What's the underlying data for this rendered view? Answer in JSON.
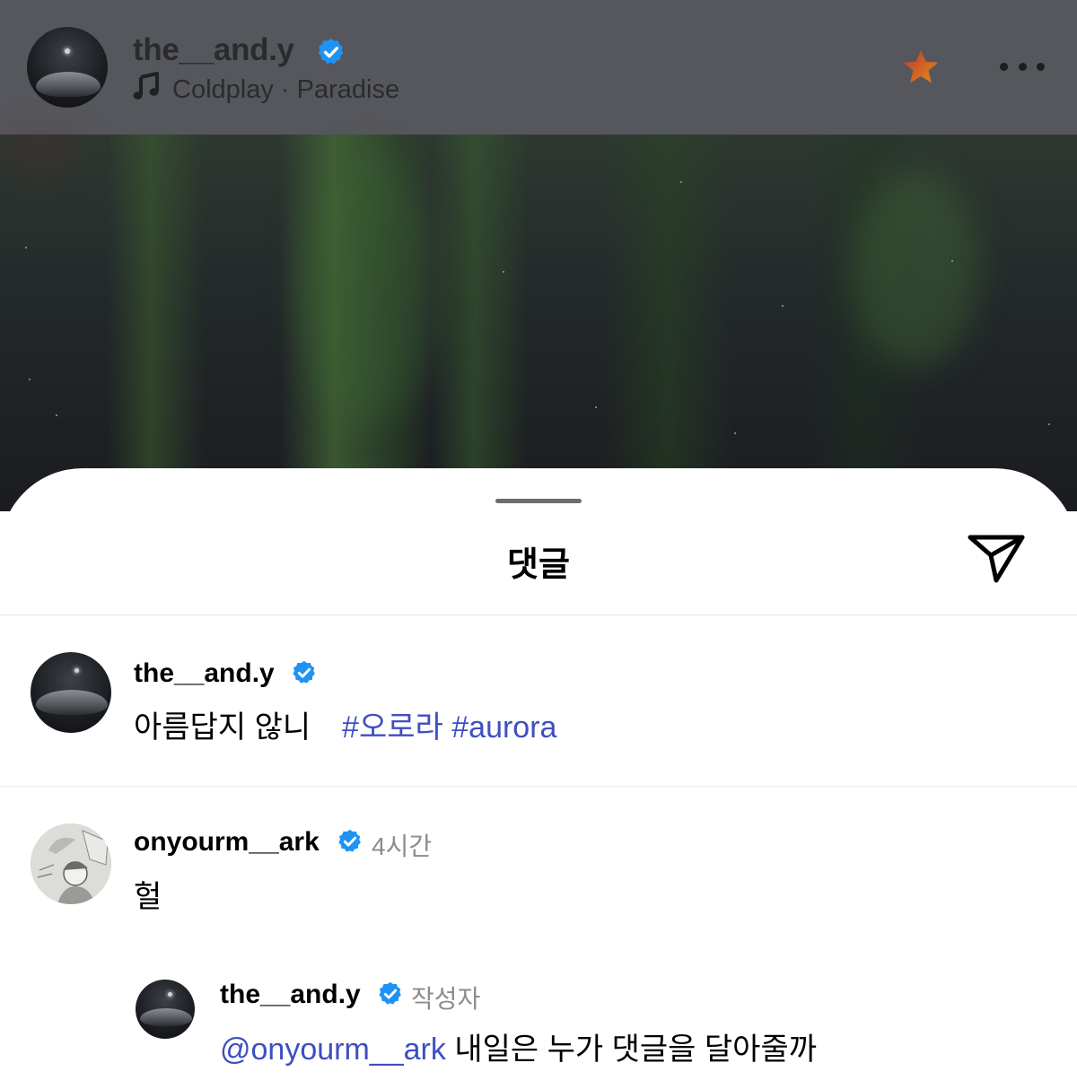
{
  "header": {
    "username": "the__and.y",
    "music_artist": "Coldplay",
    "music_separator": " · ",
    "music_track": "Paradise"
  },
  "sheet": {
    "title": "댓글"
  },
  "comments": [
    {
      "username": "the__and.y",
      "text": "아름답지 않니",
      "hashtags": [
        "#오로라",
        "#aurora"
      ]
    },
    {
      "username": "onyourm__ark",
      "time": "4시간",
      "text": "헐"
    }
  ],
  "reply": {
    "username": "the__and.y",
    "badge": "작성자",
    "mention": "@onyourm__ark",
    "text": "내일은 누가 댓글을 달아줄까"
  },
  "colors": {
    "verified": "#1f93f5",
    "hashtag": "#3d4fc2",
    "header_overlay": "#56575c"
  },
  "icons": [
    "verified-badge-icon",
    "music-note-icon",
    "star-icon",
    "more-icon",
    "send-icon"
  ]
}
